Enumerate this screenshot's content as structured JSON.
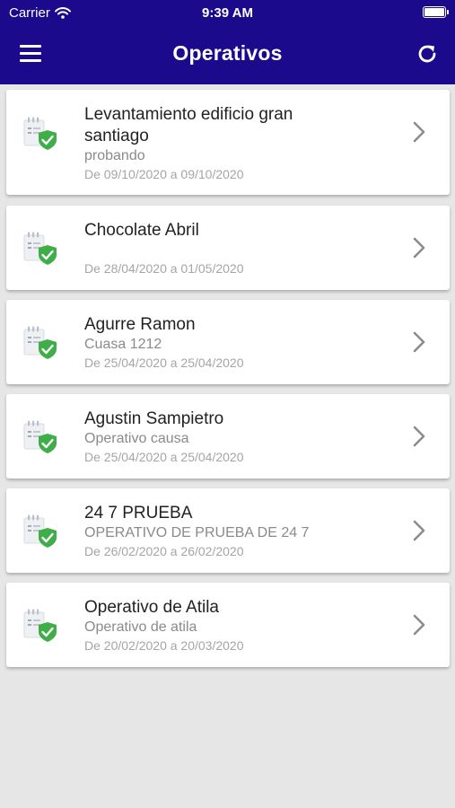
{
  "status_bar": {
    "carrier": "Carrier",
    "time": "9:39 AM"
  },
  "header": {
    "title": "Operativos"
  },
  "colors": {
    "header_bg": "#1c0a8c",
    "shield_green": "#3fae49",
    "page_bg": "#e6e6e6"
  },
  "icons": {
    "menu": "menu-icon",
    "refresh": "refresh-icon",
    "item": "clipboard-shield-icon",
    "chevron": "chevron-right-icon"
  },
  "operativos": [
    {
      "name_lines": [
        "Levantamiento edificio gran",
        "santiago"
      ],
      "description": "probando",
      "dates": "De 09/10/2020 a 09/10/2020"
    },
    {
      "name_lines": [
        "Chocolate Abril"
      ],
      "description": "",
      "dates": "De 28/04/2020 a 01/05/2020"
    },
    {
      "name_lines": [
        "Agurre Ramon"
      ],
      "description": "Cuasa 1212",
      "dates": "De 25/04/2020 a 25/04/2020"
    },
    {
      "name_lines": [
        "Agustin Sampietro"
      ],
      "description": "Operativo causa",
      "dates": "De 25/04/2020 a 25/04/2020"
    },
    {
      "name_lines": [
        "24 7 PRUEBA"
      ],
      "description": "OPERATIVO DE PRUEBA DE 24 7",
      "dates": "De 26/02/2020 a 26/02/2020"
    },
    {
      "name_lines": [
        "Operativo de Atila"
      ],
      "description": "Operativo de atila",
      "dates": "De 20/02/2020 a 20/03/2020"
    }
  ]
}
